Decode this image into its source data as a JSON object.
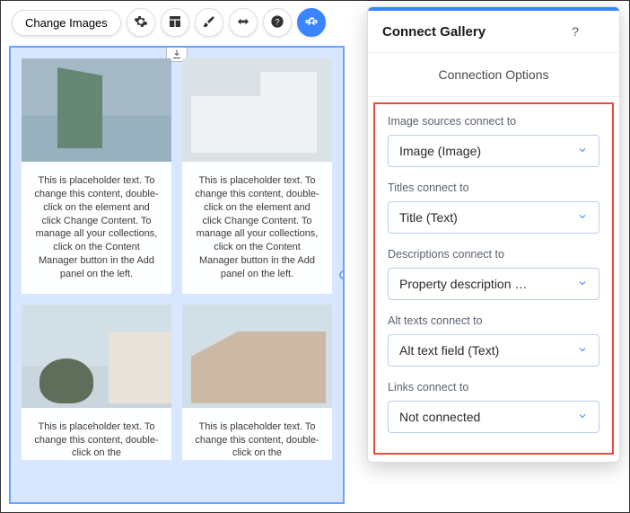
{
  "toolbar": {
    "change_images_label": "Change Images"
  },
  "canvas": {
    "placeholder_full": "This is placeholder text. To change this content, double-click on the element and click Change Content. To manage all your collections, click on the Content Manager button in the Add panel on the left.",
    "placeholder_short": "This is placeholder text. To change this content, double-click on the"
  },
  "panel": {
    "title": "Connect Gallery",
    "section": "Connection Options",
    "fields": {
      "image_sources": {
        "label": "Image sources connect to",
        "value": "Image (Image)"
      },
      "titles": {
        "label": "Titles connect to",
        "value": "Title (Text)"
      },
      "descriptions": {
        "label": "Descriptions connect to",
        "value": "Property description …"
      },
      "alt_texts": {
        "label": "Alt texts connect to",
        "value": "Alt text field (Text)"
      },
      "links": {
        "label": "Links connect to",
        "value": "Not connected"
      }
    }
  }
}
